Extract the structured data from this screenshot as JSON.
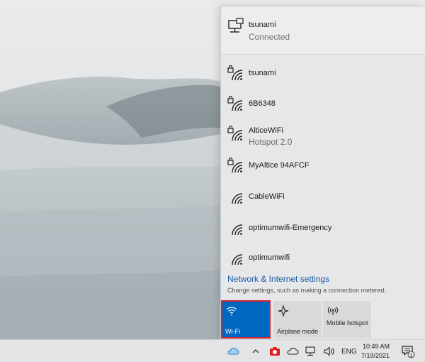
{
  "connected_network": {
    "name": "tsunami",
    "status": "Connected"
  },
  "networks": [
    {
      "name": "tsunami",
      "secured": true,
      "sub": ""
    },
    {
      "name": "6B6348",
      "secured": true,
      "sub": ""
    },
    {
      "name": "AlticeWiFi",
      "secured": true,
      "sub": "Hotspot 2.0"
    },
    {
      "name": "MyAltice 94AFCF",
      "secured": true,
      "sub": ""
    },
    {
      "name": "CableWiFi",
      "secured": false,
      "sub": ""
    },
    {
      "name": "optimumwifi-Emergency",
      "secured": false,
      "sub": ""
    },
    {
      "name": "optimumwifi",
      "secured": false,
      "sub": ""
    }
  ],
  "settings": {
    "link": "Network & Internet settings",
    "description": "Change settings, such as making a connection metered."
  },
  "quick_actions": [
    {
      "label": "Wi-Fi",
      "icon": "wifi-icon",
      "active": true
    },
    {
      "label": "Airplane mode",
      "icon": "airplane-icon",
      "active": false
    },
    {
      "label": "Mobile hotspot",
      "icon": "hotspot-icon",
      "active": false
    }
  ],
  "taskbar": {
    "language": "ENG",
    "time": "10:49 AM",
    "date": "7/19/2021",
    "notification_count": "1"
  },
  "colors": {
    "accent": "#0067c0",
    "highlight_outline": "#d6212f",
    "link": "#1a5aa6"
  }
}
